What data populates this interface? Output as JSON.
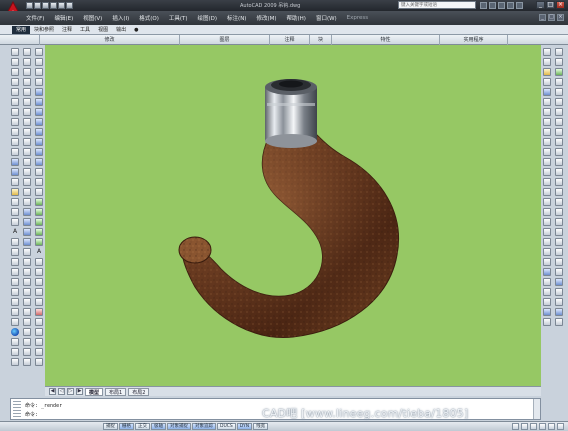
{
  "window": {
    "title": "AutoCAD 2009 吊钩.dwg",
    "search_placeholder": "键入关键字或短语"
  },
  "menu": {
    "items": [
      "文件(F)",
      "编辑(E)",
      "视图(V)",
      "插入(I)",
      "格式(O)",
      "工具(T)",
      "绘图(D)",
      "标注(N)",
      "修改(M)",
      "帮助(H)",
      "窗口(W)",
      "Express"
    ]
  },
  "ribbon": {
    "tabs": [
      "常用",
      "块和参照",
      "注释",
      "工具",
      "视图",
      "输出"
    ],
    "panels": [
      "修改",
      "图层",
      "注释",
      "块",
      "特性",
      "实用程序"
    ]
  },
  "layout_tabs": [
    "模型",
    "布局1",
    "布局2"
  ],
  "command": {
    "prompt": "命令:",
    "line": "命令: _render"
  },
  "status": {
    "coords": "",
    "toggles": [
      "捕捉",
      "栅格",
      "正交",
      "极轴",
      "对象捕捉",
      "对象追踪",
      "DUCS",
      "DYN",
      "线宽"
    ]
  },
  "watermark": "CAD吧   [www.lineeg.com/tieba/1805]",
  "colors": {
    "canvas_background": "#96c864",
    "hook_rust": "#6b3a1f",
    "cap_metal": "#b9bec4"
  }
}
